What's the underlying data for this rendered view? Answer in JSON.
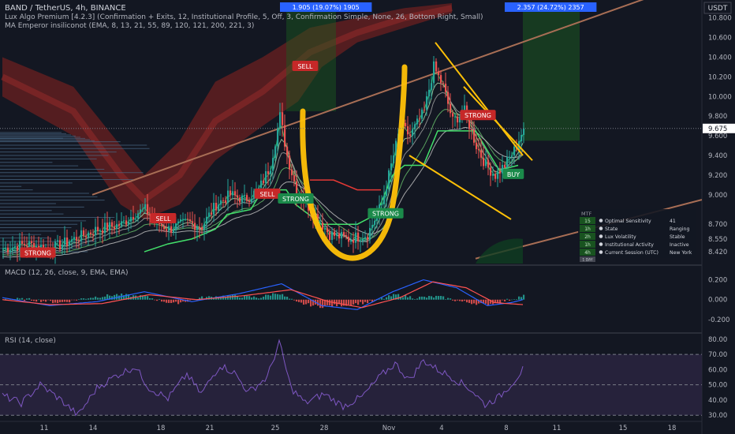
{
  "header": {
    "symbol_line": "BAND / TetherUS, 4h, BINANCE",
    "indicator_1": "Lux Algo Premium [4.2.3] (Confirmation + Exits, 12, Institutional Profile, 5, Off, 3, Confirmation Simple, None, 26, Bottom Right, Small)",
    "indicator_2": "MA Emperor insiliconot (EMA, 8, 13, 21, 55, 89, 120, 121, 200, 221, 3)"
  },
  "measure_boxes": [
    {
      "label": "1.905 (19.07%) 1905",
      "color": "#2962ff"
    },
    {
      "label": "2.357 (24.72%) 2357",
      "color": "#2962ff"
    }
  ],
  "currency": "USDT",
  "last_price": "9.675",
  "colors": {
    "background": "#131722",
    "candle_up": "#26a69a",
    "candle_down": "#ef5350",
    "annotation": "#ffc107",
    "macd_line": "#2962ff",
    "signal_line": "#ff5252",
    "rsi_line": "#7e57c2",
    "rsi_band": "#2a2440",
    "cloud": "#6b2020"
  },
  "signals": [
    {
      "label": "SELL",
      "kind": "sell"
    },
    {
      "label": "SELL",
      "kind": "sell"
    },
    {
      "label": "SELL",
      "kind": "sell"
    },
    {
      "label": "STRONG",
      "kind": "sell"
    },
    {
      "label": "STRONG",
      "kind": "sell"
    },
    {
      "label": "STRONG",
      "kind": "buy"
    },
    {
      "label": "STRONG",
      "kind": "buy"
    },
    {
      "label": "BUY",
      "kind": "buy"
    }
  ],
  "dashboard": {
    "header": "MTF",
    "rows": [
      {
        "tf": "15",
        "name": "Optimal Sensitivity",
        "value": "41"
      },
      {
        "tf": "1h",
        "name": "State",
        "value": "Ranging"
      },
      {
        "tf": "2h",
        "name": "Lux Volatility",
        "value": "Stable"
      },
      {
        "tf": "1h",
        "name": "Institutional Activity",
        "value": "Inactive"
      },
      {
        "tf": "4h",
        "name": "Current Session (UTC)",
        "value": "New York"
      }
    ],
    "footer": "1 DAY"
  },
  "macd_pane": {
    "title": "MACD (12, 26, close, 9, EMA, EMA)",
    "ticks": [
      "0.200",
      "0.000",
      "-0.200"
    ],
    "tick_values": [
      0.2,
      0.0,
      -0.2
    ]
  },
  "rsi_pane": {
    "title": "RSI (14, close)",
    "ticks": [
      "80.00",
      "70.00",
      "60.00",
      "50.00",
      "40.00",
      "30.00"
    ],
    "tick_values": [
      80,
      70,
      60,
      50,
      40,
      30
    ]
  },
  "chart_data": [
    {
      "type": "candlestick",
      "title": "BAND / TetherUS, 4h, BINANCE",
      "x_ticks": [
        "11",
        "14",
        "18",
        "21",
        "25",
        "28",
        "Nov",
        "4",
        "8",
        "11",
        "15",
        "18"
      ],
      "y_ticks": [
        10.8,
        10.6,
        10.4,
        10.2,
        10.0,
        9.8,
        9.6,
        9.4,
        9.2,
        9.0,
        8.7,
        8.55,
        8.42
      ],
      "y_tick_labels": [
        "10.800",
        "10.600",
        "10.400",
        "10.200",
        "10.000",
        "9.800",
        "9.600",
        "9.400",
        "9.200",
        "9.000",
        "8.700",
        "8.550",
        "8.420"
      ],
      "ylim": [
        8.3,
        10.95
      ],
      "close_path_points": [
        {
          "i": 0,
          "v": 8.45
        },
        {
          "i": 10,
          "v": 8.5
        },
        {
          "i": 20,
          "v": 8.45
        },
        {
          "i": 30,
          "v": 8.55
        },
        {
          "i": 40,
          "v": 8.65
        },
        {
          "i": 50,
          "v": 8.7
        },
        {
          "i": 55,
          "v": 8.8
        },
        {
          "i": 60,
          "v": 8.85
        },
        {
          "i": 65,
          "v": 8.72
        },
        {
          "i": 70,
          "v": 8.65
        },
        {
          "i": 78,
          "v": 8.72
        },
        {
          "i": 84,
          "v": 8.68
        },
        {
          "i": 90,
          "v": 8.9
        },
        {
          "i": 96,
          "v": 9.0
        },
        {
          "i": 102,
          "v": 8.95
        },
        {
          "i": 108,
          "v": 9.05
        },
        {
          "i": 113,
          "v": 9.3
        },
        {
          "i": 117,
          "v": 9.8
        },
        {
          "i": 120,
          "v": 9.4
        },
        {
          "i": 124,
          "v": 9.05
        },
        {
          "i": 130,
          "v": 8.85
        },
        {
          "i": 138,
          "v": 8.6
        },
        {
          "i": 146,
          "v": 8.55
        },
        {
          "i": 154,
          "v": 8.6
        },
        {
          "i": 160,
          "v": 8.9
        },
        {
          "i": 164,
          "v": 9.3
        },
        {
          "i": 168,
          "v": 9.7
        },
        {
          "i": 172,
          "v": 9.6
        },
        {
          "i": 178,
          "v": 9.85
        },
        {
          "i": 182,
          "v": 10.3
        },
        {
          "i": 186,
          "v": 10.1
        },
        {
          "i": 190,
          "v": 9.75
        },
        {
          "i": 195,
          "v": 9.85
        },
        {
          "i": 200,
          "v": 9.5
        },
        {
          "i": 204,
          "v": 9.3
        },
        {
          "i": 208,
          "v": 9.2
        },
        {
          "i": 212,
          "v": 9.3
        },
        {
          "i": 216,
          "v": 9.45
        },
        {
          "i": 220,
          "v": 9.675
        }
      ],
      "last_price": 9.675
    },
    {
      "type": "bar",
      "title": "MACD (12, 26, close, 9, EMA, EMA)",
      "ylim": [
        -0.32,
        0.3
      ],
      "histogram_points": [
        {
          "i": 0,
          "v": 0.01
        },
        {
          "i": 12,
          "v": 0.0
        },
        {
          "i": 24,
          "v": -0.03
        },
        {
          "i": 36,
          "v": 0.02
        },
        {
          "i": 48,
          "v": 0.05
        },
        {
          "i": 60,
          "v": 0.03
        },
        {
          "i": 72,
          "v": -0.04
        },
        {
          "i": 84,
          "v": 0.02
        },
        {
          "i": 96,
          "v": 0.04
        },
        {
          "i": 108,
          "v": 0.02
        },
        {
          "i": 116,
          "v": 0.07
        },
        {
          "i": 124,
          "v": -0.03
        },
        {
          "i": 134,
          "v": -0.07
        },
        {
          "i": 146,
          "v": -0.05
        },
        {
          "i": 156,
          "v": -0.02
        },
        {
          "i": 166,
          "v": 0.05
        },
        {
          "i": 174,
          "v": 0.02
        },
        {
          "i": 184,
          "v": 0.03
        },
        {
          "i": 194,
          "v": -0.02
        },
        {
          "i": 204,
          "v": -0.05
        },
        {
          "i": 214,
          "v": 0.0
        },
        {
          "i": 220,
          "v": 0.04
        }
      ],
      "macd_points": [
        {
          "i": 0,
          "v": 0.02
        },
        {
          "i": 20,
          "v": -0.06
        },
        {
          "i": 40,
          "v": -0.02
        },
        {
          "i": 60,
          "v": 0.08
        },
        {
          "i": 80,
          "v": -0.02
        },
        {
          "i": 100,
          "v": 0.06
        },
        {
          "i": 118,
          "v": 0.16
        },
        {
          "i": 135,
          "v": -0.06
        },
        {
          "i": 150,
          "v": -0.1
        },
        {
          "i": 165,
          "v": 0.08
        },
        {
          "i": 178,
          "v": 0.2
        },
        {
          "i": 192,
          "v": 0.12
        },
        {
          "i": 205,
          "v": -0.06
        },
        {
          "i": 215,
          "v": -0.03
        },
        {
          "i": 220,
          "v": 0.0
        }
      ],
      "signal_points": [
        {
          "i": 0,
          "v": 0.0
        },
        {
          "i": 20,
          "v": -0.05
        },
        {
          "i": 42,
          "v": -0.04
        },
        {
          "i": 62,
          "v": 0.05
        },
        {
          "i": 82,
          "v": 0.0
        },
        {
          "i": 102,
          "v": 0.04
        },
        {
          "i": 122,
          "v": 0.1
        },
        {
          "i": 138,
          "v": -0.02
        },
        {
          "i": 152,
          "v": -0.08
        },
        {
          "i": 168,
          "v": 0.02
        },
        {
          "i": 182,
          "v": 0.18
        },
        {
          "i": 196,
          "v": 0.12
        },
        {
          "i": 208,
          "v": -0.03
        },
        {
          "i": 220,
          "v": -0.05
        }
      ]
    },
    {
      "type": "line",
      "title": "RSI (14, close)",
      "ylim": [
        27,
        82
      ],
      "rsi_points": [
        {
          "i": 0,
          "v": 43
        },
        {
          "i": 8,
          "v": 38
        },
        {
          "i": 16,
          "v": 50
        },
        {
          "i": 24,
          "v": 41
        },
        {
          "i": 32,
          "v": 30
        },
        {
          "i": 40,
          "v": 48
        },
        {
          "i": 48,
          "v": 56
        },
        {
          "i": 56,
          "v": 62
        },
        {
          "i": 62,
          "v": 48
        },
        {
          "i": 70,
          "v": 41
        },
        {
          "i": 78,
          "v": 57
        },
        {
          "i": 84,
          "v": 44
        },
        {
          "i": 92,
          "v": 63
        },
        {
          "i": 98,
          "v": 58
        },
        {
          "i": 104,
          "v": 45
        },
        {
          "i": 112,
          "v": 55
        },
        {
          "i": 117,
          "v": 78
        },
        {
          "i": 122,
          "v": 48
        },
        {
          "i": 128,
          "v": 38
        },
        {
          "i": 136,
          "v": 44
        },
        {
          "i": 144,
          "v": 36
        },
        {
          "i": 152,
          "v": 42
        },
        {
          "i": 160,
          "v": 56
        },
        {
          "i": 166,
          "v": 64
        },
        {
          "i": 172,
          "v": 53
        },
        {
          "i": 178,
          "v": 66
        },
        {
          "i": 184,
          "v": 60
        },
        {
          "i": 190,
          "v": 55
        },
        {
          "i": 198,
          "v": 47
        },
        {
          "i": 204,
          "v": 37
        },
        {
          "i": 210,
          "v": 42
        },
        {
          "i": 216,
          "v": 52
        },
        {
          "i": 220,
          "v": 60
        }
      ]
    }
  ]
}
